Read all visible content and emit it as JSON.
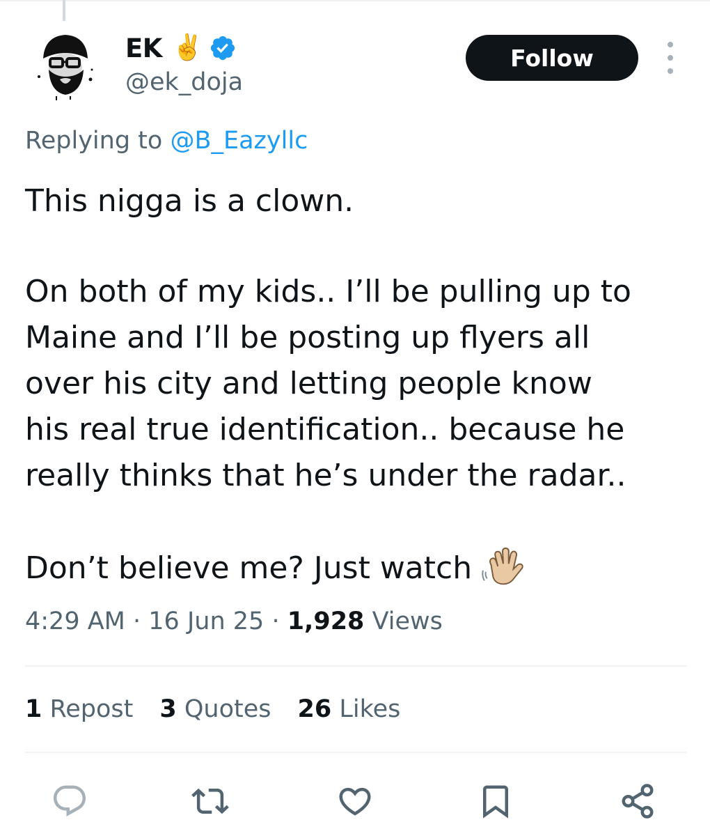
{
  "author": {
    "name": "EK",
    "name_emoji": "✌️",
    "handle": "@ek_doja",
    "verified_color": "#1d9bf0"
  },
  "follow_button": {
    "label": "Follow"
  },
  "reply": {
    "prefix": "Replying to",
    "to_handle": "@B_Eazyllc"
  },
  "tweet": {
    "line1": "This nigga is a clown.",
    "para2_lines": [
      "On both of my kids.. I’ll be pulling up to",
      "Maine and I’ll be posting up flyers all",
      "over his city and letting  people know",
      "his real true identification.. because he",
      "really thinks that he’s under the radar.."
    ],
    "para3": "Don’t believe me? Just watch"
  },
  "meta": {
    "time": "4:29 AM",
    "date": "16 Jun 25",
    "views_count": "1,928",
    "views_label": "Views"
  },
  "stats": {
    "reposts_count": "1",
    "reposts_label": "Repost",
    "quotes_count": "3",
    "quotes_label": "Quotes",
    "likes_count": "26",
    "likes_label": "Likes"
  },
  "colors": {
    "text": "#0f1419",
    "secondary": "#536471",
    "link": "#1d9bf0",
    "icon": "#536471",
    "reply_icon": "#a7b1b9"
  },
  "icons": [
    "reply-icon",
    "repost-icon",
    "like-icon",
    "bookmark-icon",
    "share-icon"
  ]
}
